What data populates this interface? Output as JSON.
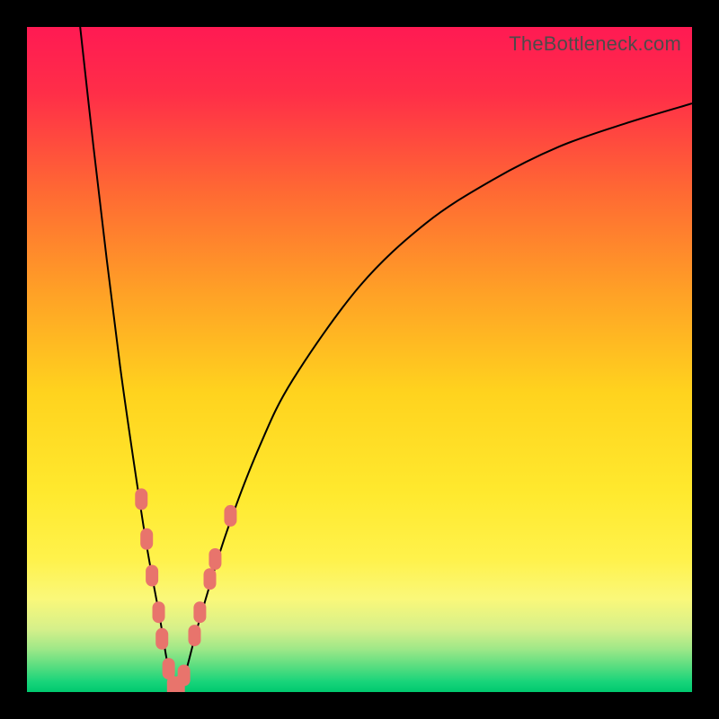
{
  "watermark": "TheBottleneck.com",
  "chart_data": {
    "type": "line",
    "title": "",
    "xlabel": "",
    "ylabel": "",
    "xlim": [
      0,
      100
    ],
    "ylim": [
      0,
      100
    ],
    "curve": {
      "name": "bottleneck-curve",
      "minimum_x": 22,
      "points": [
        {
          "x": 8.0,
          "y": 100.0
        },
        {
          "x": 10.0,
          "y": 82.0
        },
        {
          "x": 12.0,
          "y": 65.0
        },
        {
          "x": 14.0,
          "y": 49.0
        },
        {
          "x": 16.0,
          "y": 35.0
        },
        {
          "x": 18.0,
          "y": 22.0
        },
        {
          "x": 20.0,
          "y": 11.0
        },
        {
          "x": 21.0,
          "y": 5.0
        },
        {
          "x": 22.0,
          "y": 0.5
        },
        {
          "x": 23.0,
          "y": 1.0
        },
        {
          "x": 24.0,
          "y": 3.5
        },
        {
          "x": 26.0,
          "y": 11.0
        },
        {
          "x": 30.0,
          "y": 24.0
        },
        {
          "x": 35.0,
          "y": 37.0
        },
        {
          "x": 40.0,
          "y": 47.0
        },
        {
          "x": 50.0,
          "y": 61.0
        },
        {
          "x": 60.0,
          "y": 70.5
        },
        {
          "x": 70.0,
          "y": 77.0
        },
        {
          "x": 80.0,
          "y": 82.0
        },
        {
          "x": 90.0,
          "y": 85.5
        },
        {
          "x": 100.0,
          "y": 88.5
        }
      ]
    },
    "markers": [
      {
        "x": 17.2,
        "y": 29.0
      },
      {
        "x": 18.0,
        "y": 23.0
      },
      {
        "x": 18.8,
        "y": 17.5
      },
      {
        "x": 19.8,
        "y": 12.0
      },
      {
        "x": 20.3,
        "y": 8.0
      },
      {
        "x": 21.3,
        "y": 3.5
      },
      {
        "x": 22.0,
        "y": 0.8
      },
      {
        "x": 22.8,
        "y": 0.8
      },
      {
        "x": 23.6,
        "y": 2.5
      },
      {
        "x": 25.2,
        "y": 8.5
      },
      {
        "x": 26.0,
        "y": 12.0
      },
      {
        "x": 27.5,
        "y": 17.0
      },
      {
        "x": 28.3,
        "y": 20.0
      },
      {
        "x": 30.6,
        "y": 26.5
      }
    ],
    "marker_color": "#e8746c",
    "curve_color": "#000000",
    "gradient_stops": [
      {
        "pos": 0.0,
        "color": "#ff1a53"
      },
      {
        "pos": 0.1,
        "color": "#ff2e48"
      },
      {
        "pos": 0.25,
        "color": "#ff6a33"
      },
      {
        "pos": 0.4,
        "color": "#ffa126"
      },
      {
        "pos": 0.55,
        "color": "#ffd31e"
      },
      {
        "pos": 0.7,
        "color": "#ffe92e"
      },
      {
        "pos": 0.8,
        "color": "#fff24b"
      },
      {
        "pos": 0.86,
        "color": "#faf87a"
      },
      {
        "pos": 0.905,
        "color": "#d6f08a"
      },
      {
        "pos": 0.935,
        "color": "#9fe888"
      },
      {
        "pos": 0.965,
        "color": "#4fdc7f"
      },
      {
        "pos": 0.985,
        "color": "#17d47a"
      },
      {
        "pos": 1.0,
        "color": "#00c96f"
      }
    ]
  }
}
